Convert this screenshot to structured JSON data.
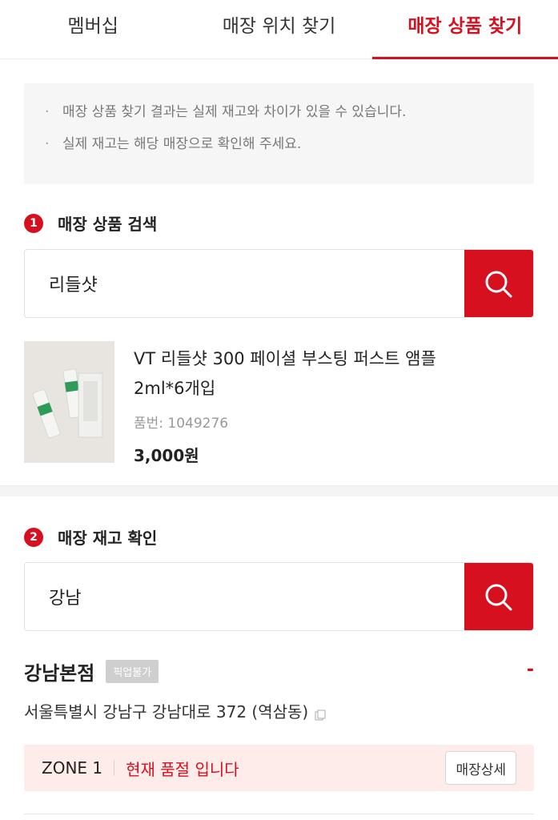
{
  "tabs": [
    {
      "label": "멤버십",
      "active": false
    },
    {
      "label": "매장 위치 찾기",
      "active": false
    },
    {
      "label": "매장 상품 찾기",
      "active": true
    }
  ],
  "notice": {
    "items": [
      "매장 상품 찾기 결과는 실제 재고와 차이가 있을 수 있습니다.",
      "실제 재고는 해당 매장으로 확인해 주세요."
    ]
  },
  "product_search": {
    "step": "1",
    "title": "매장 상품 검색",
    "value": "리들샷",
    "button_icon": "search-icon"
  },
  "product": {
    "name": "VT 리들샷 300 페이셜 부스팅 퍼스트 앰플 2ml*6개입",
    "code_label": "품번: 1049276",
    "price": "3,000원"
  },
  "stock_check": {
    "step": "2",
    "title": "매장 재고 확인",
    "value": "강남",
    "button_icon": "search-icon"
  },
  "store": {
    "name": "강남본점",
    "badge": "픽업불가",
    "collapse_symbol": "-",
    "address": "서울특별시 강남구 강남대로 372 (역삼동)",
    "zone": {
      "name": "ZONE 1",
      "status": "현재 품절 입니다",
      "detail_button": "매장상세"
    }
  },
  "colors": {
    "accent": "#d7101f",
    "zone_bg": "#fdecea",
    "notice_bg": "#f6f6f6"
  }
}
